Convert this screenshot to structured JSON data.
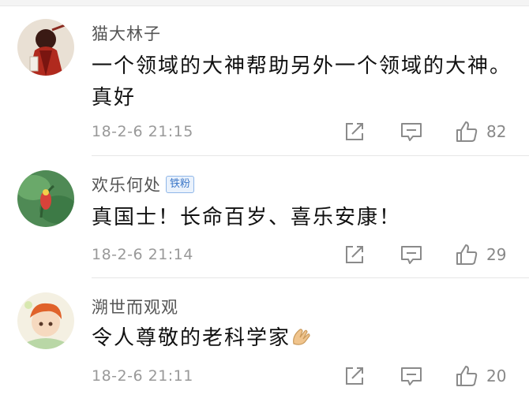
{
  "comments": [
    {
      "user": "猫大林子",
      "text": "一个领域的大神帮助另外一个领域的大神。真好",
      "time": "18-2-6 21:15",
      "likes": "82",
      "badge": ""
    },
    {
      "user": "欢乐何处",
      "text": "真国士！长命百岁、喜乐安康！",
      "time": "18-2-6 21:14",
      "likes": "29",
      "badge": "铁粉"
    },
    {
      "user": "溯世而观观",
      "text": "令人尊敬的老科学家",
      "time": "18-2-6 21:11",
      "likes": "20",
      "badge": ""
    }
  ],
  "icons": {
    "share": "share-icon",
    "reply": "comment-icon",
    "like": "thumbs-up-icon",
    "emoji": "clap-hands-emoji"
  },
  "colors": {
    "username": "#555555",
    "text": "#111111",
    "meta": "#999999",
    "badge": "#3d78c8"
  }
}
